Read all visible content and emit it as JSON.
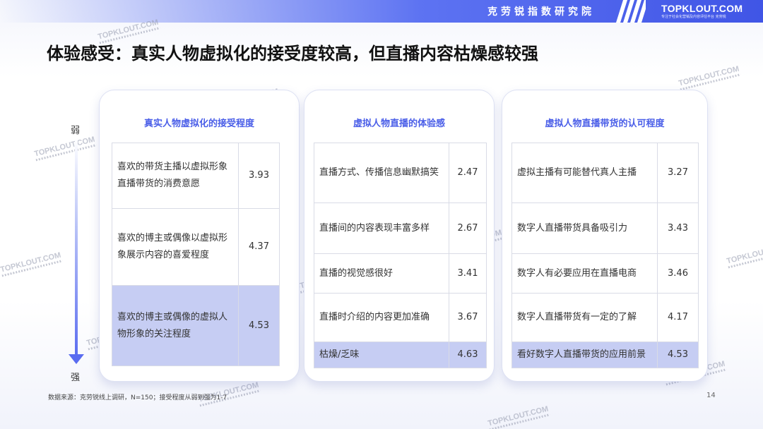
{
  "header": {
    "org_name": "克劳锐指数研究院",
    "brand": "TOPKLOUT.COM",
    "brand_sub": "专注于社会化营销及内容评估平台 克劳锐"
  },
  "title": "体验感受：真实人物虚拟化的接受度较高，但直播内容枯燥感较强",
  "scale": {
    "weak": "弱",
    "strong": "强"
  },
  "panels": [
    {
      "title": "真实人物虚拟化的接受程度",
      "rows": [
        {
          "label": "喜欢的带货主播以虚拟形象直播带货的消费意愿",
          "value": "3.93"
        },
        {
          "label": "喜欢的博主或偶像以虚拟形象展示内容的喜爱程度",
          "value": "4.37"
        },
        {
          "label": "喜欢的博主或偶像的虚拟人物形象的关注程度",
          "value": "4.53"
        }
      ]
    },
    {
      "title": "虚拟人物直播的体验感",
      "rows": [
        {
          "label": "直播方式、传播信息幽默搞笑",
          "value": "2.47"
        },
        {
          "label": "直播间的内容表现丰富多样",
          "value": "2.67"
        },
        {
          "label": "直播的视觉感很好",
          "value": "3.41"
        },
        {
          "label": "直播时介绍的内容更加准确",
          "value": "3.67"
        },
        {
          "label": "枯燥/乏味",
          "value": "4.63"
        }
      ]
    },
    {
      "title": "虚拟人物直播带货的认可程度",
      "rows": [
        {
          "label": "虚拟主播有可能替代真人主播",
          "value": "3.27"
        },
        {
          "label": "数字人直播带货具备吸引力",
          "value": "3.43"
        },
        {
          "label": "数字人有必要应用在直播电商",
          "value": "3.46"
        },
        {
          "label": "数字人直播带货有一定的了解",
          "value": "4.17"
        },
        {
          "label": "看好数字人直播带货的应用前景",
          "value": "4.53"
        }
      ]
    }
  ],
  "footer": {
    "source": "数据来源：克劳锐线上调研，N=150；接受程度从弱到强为1-7",
    "page": "14"
  },
  "watermark": "TOPKLOUT.COM",
  "colors": {
    "accent": "#4a5ee8",
    "highlight": "#c6cdf3",
    "banner": "#5d73f2"
  }
}
